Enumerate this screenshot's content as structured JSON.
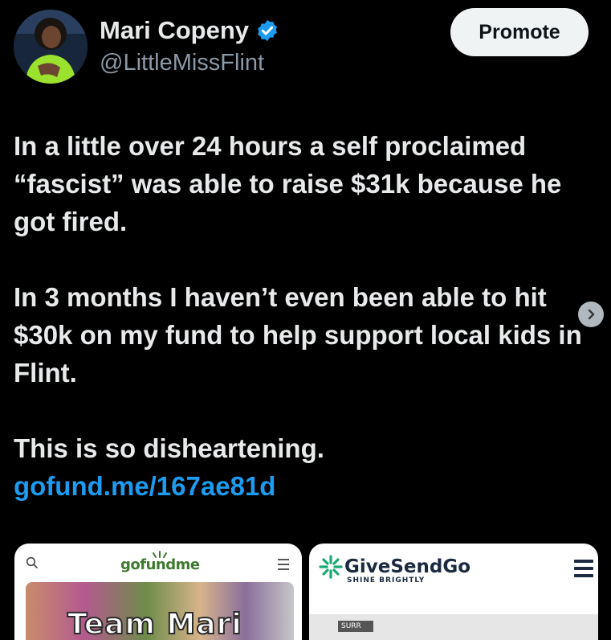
{
  "author": {
    "name": "Mari Copeny",
    "handle": "@LittleMissFlint",
    "verified_icon": "verified-badge-icon",
    "accent_color": "#1d9bf0"
  },
  "actions": {
    "promote_label": "Promote"
  },
  "tweet": {
    "paragraph1": "In a little over 24 hours a self proclaimed “fascist” was able to raise $31k because he got fired.",
    "paragraph2": "In 3 months I haven’t even been able to hit $30k on my fund to help support local kids in Flint.",
    "paragraph3": "This is so disheartening.",
    "link": "gofund.me/167ae81d"
  },
  "media": {
    "card1": {
      "logo_text": "gofundme",
      "banner_text": "Team Mari"
    },
    "card2": {
      "logo_text": "GiveSendGo",
      "tagline": "SHINE BRIGHTLY",
      "badge_text": "SURR"
    }
  }
}
